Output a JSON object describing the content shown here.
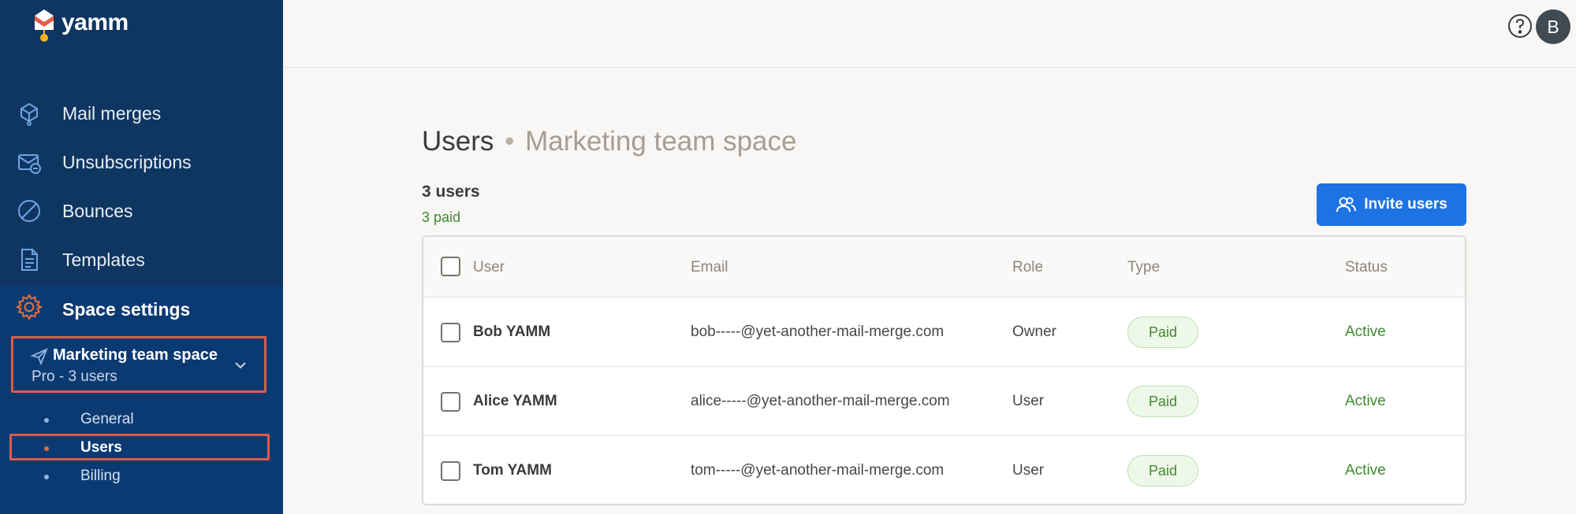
{
  "app": {
    "name": "yamm"
  },
  "sidebar": {
    "nav": [
      {
        "label": "Mail merges",
        "icon": "mail-merges-icon"
      },
      {
        "label": "Unsubscriptions",
        "icon": "unsubscribe-icon"
      },
      {
        "label": "Bounces",
        "icon": "bounces-icon"
      },
      {
        "label": "Templates",
        "icon": "templates-icon"
      }
    ],
    "settings": {
      "label": "Space settings",
      "space_name": "Marketing team space",
      "space_plan": "Pro - 3 users",
      "sub_items": [
        {
          "label": "General"
        },
        {
          "label": "Users",
          "active": true
        },
        {
          "label": "Billing"
        }
      ]
    }
  },
  "topbar": {
    "avatar_initial": "B"
  },
  "main": {
    "title": "Users",
    "separator": "•",
    "space_name": "Marketing team space",
    "user_count": "3 users",
    "paid_count": "3 paid",
    "invite_label": "Invite users",
    "columns": [
      "User",
      "Email",
      "Role",
      "Type",
      "Status"
    ],
    "rows": [
      {
        "name": "Bob YAMM",
        "email": "bob-----@yet-another-mail-merge.com",
        "role": "Owner",
        "type": "Paid",
        "status": "Active"
      },
      {
        "name": "Alice YAMM",
        "email": "alice-----@yet-another-mail-merge.com",
        "role": "User",
        "type": "Paid",
        "status": "Active"
      },
      {
        "name": "Tom YAMM",
        "email": "tom-----@yet-another-mail-merge.com",
        "role": "User",
        "type": "Paid",
        "status": "Active"
      }
    ]
  },
  "colors": {
    "sidebar": "#0f3661",
    "accent": "#1d73e2",
    "highlight": "#e05a47",
    "success": "#3f8a2f"
  }
}
